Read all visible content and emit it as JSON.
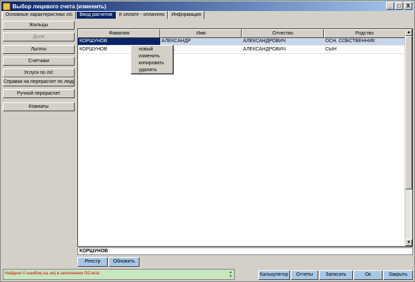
{
  "window": {
    "title": "Выбор лицевого счета (изменить)",
    "controls": [
      "_",
      "□",
      "X"
    ]
  },
  "tabs": [
    {
      "label": "Основные характеристики л/с",
      "active": false
    },
    {
      "label": "Ввод расчетов",
      "active": true
    },
    {
      "label": "К оплате - оплачено",
      "active": false
    },
    {
      "label": "Информация",
      "active": false
    }
  ],
  "sidebar": {
    "items": [
      {
        "label": "Жильцы",
        "enabled": true
      },
      {
        "label": "Доли",
        "enabled": false
      },
      {
        "label": "Льготы",
        "enabled": true
      },
      {
        "label": "Счетчики",
        "enabled": true
      },
      {
        "label": "Услуги по л/с",
        "enabled": true
      },
      {
        "label": "Справки на перерасчет по людям",
        "enabled": true
      },
      {
        "label": "Ручной перерасчет",
        "enabled": true
      },
      {
        "label": "Комнаты",
        "enabled": true
      }
    ]
  },
  "grid": {
    "columns": [
      "Фамилия",
      "Имя",
      "Отчество",
      "Родство"
    ],
    "rows": [
      [
        "КОРШУНОВ",
        "АЛЕКСАНДР",
        "АЛЕКСАНДРОВИЧ",
        "ОСН. СОБСТВЕННИК"
      ],
      [
        "КОРШУНОВ",
        "СЛАВ",
        "АЛЕКСАНДРОВИЧ",
        "СЫН"
      ]
    ],
    "scroll_up": "▲",
    "scroll_down": "▼"
  },
  "context_menu": {
    "items": [
      "новый",
      "изменить",
      "копировать",
      "удалить"
    ]
  },
  "selected_surname": "КОРШУНОВ",
  "actions": {
    "registry": "Реестр",
    "refresh": "Обновить"
  },
  "message": {
    "text": "Найдено 0 ошибок(-ка,-ки) в заполнении Л/Счета",
    "spin_up": "▲",
    "spin_down": "▼"
  },
  "footer": {
    "calculator": "Калькулятор",
    "reports": "Отчеты",
    "save": "Записать",
    "ok": "Ок",
    "close": "Закрыть"
  }
}
